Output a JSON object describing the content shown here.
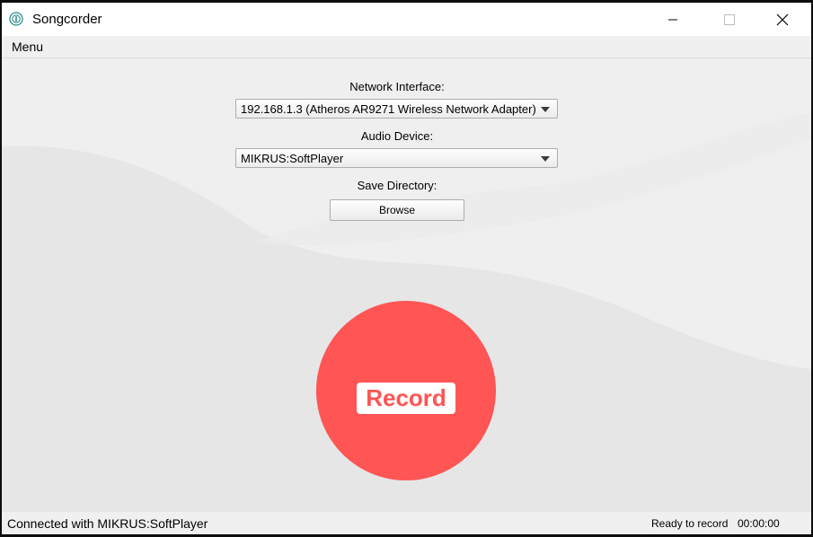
{
  "window": {
    "title": "Songcorder",
    "icon": "songcorder-logo-icon",
    "controls": [
      "minimize-icon",
      "maximize-icon",
      "close-icon"
    ]
  },
  "menubar": {
    "menu_label": "Menu"
  },
  "form": {
    "network_label": "Network Interface:",
    "network_value": "192.168.1.3 (Atheros AR9271 Wireless Network Adapter)",
    "audio_label": "Audio Device:",
    "audio_value": "MIKRUS:SoftPlayer",
    "save_label": "Save Directory:",
    "browse_label": "Browse"
  },
  "record": {
    "label": "Record",
    "color": "#ff5555"
  },
  "status": {
    "connection": "Connected with MIKRUS:SoftPlayer",
    "state": "Ready to record",
    "time": "00:00:00"
  }
}
